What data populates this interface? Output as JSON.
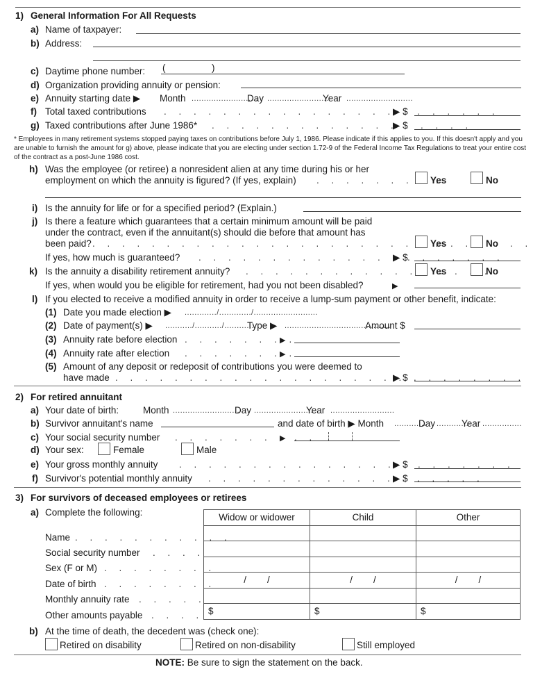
{
  "section1": {
    "num": "1)",
    "title": "General Information For All Requests",
    "a": {
      "label": "a)",
      "text": "Name of taxpayer:",
      "value": ""
    },
    "b": {
      "label": "b)",
      "text": "Address:",
      "value_line1": "",
      "value_line2": ""
    },
    "c": {
      "label": "c)",
      "text": "Daytime phone number:",
      "paren_open": "(",
      "paren_close": ")",
      "value": ""
    },
    "d": {
      "label": "d)",
      "text": "Organization providing annuity or pension:",
      "value": ""
    },
    "e": {
      "label": "e)",
      "text": "Annuity starting date ▶",
      "month": "Month",
      "day": "Day",
      "year": "Year"
    },
    "f": {
      "label": "f)",
      "text": "Total taxed contributions",
      "currency": "▶ $",
      "value": ""
    },
    "g": {
      "label": "g)",
      "text": "Taxed contributions after June 1986*",
      "currency": "▶ $",
      "value": ""
    },
    "footnote": "* Employees in many retirement systems stopped paying taxes on contributions before July 1, 1986. Please indicate if this applies to you. If this doesn't apply and you are unable to furnish the amount for g) above, please indicate that you are electing under section 1.72-9 of the Federal Income Tax Regulations to treat your entire cost of the contract as a post-June 1986 cost.",
    "h": {
      "label": "h)",
      "line1": "Was the employee (or retiree) a nonresident alien at any time during his or her",
      "line2": "employment on which the annuity is figured? (If yes, explain)",
      "yes": "Yes",
      "no": "No"
    },
    "i": {
      "label": "i)",
      "text": "Is the annuity for life or for a specified period? (Explain.)"
    },
    "j": {
      "label": "j)",
      "line1": "Is there a feature which guarantees that a certain minimum amount will be paid",
      "line2": "under the contract, even if the annuitant(s) should die before that amount has",
      "line3": "been paid?",
      "yes": "Yes",
      "no": "No",
      "followup": "If yes, how much is guaranteed?",
      "currency": "▶ $"
    },
    "k": {
      "label": "k)",
      "text": "Is the annuity a disability retirement annuity?",
      "yes": "Yes",
      "no": "No",
      "followup": "If yes, when would you be eligible for retirement, had you not been disabled?",
      "arrow": "▶"
    },
    "l": {
      "label": "l)",
      "text": "If you elected to receive a modified annuity in order to receive a lump-sum payment or other benefit, indicate:",
      "items": [
        {
          "num": "(1)",
          "text": "Date you made election ▶"
        },
        {
          "num": "(2)",
          "text": "Date of payment(s) ▶",
          "type": "Type ▶",
          "amount": "Amount  $"
        },
        {
          "num": "(3)",
          "text": "Annuity rate before election",
          "arrow": "▶"
        },
        {
          "num": "(4)",
          "text": "Annuity rate after election",
          "arrow": "▶"
        },
        {
          "num": "(5)",
          "line1": "Amount of any deposit or redeposit of contributions you were deemed to",
          "line2": "have made",
          "currency": "▶ $"
        }
      ]
    }
  },
  "section2": {
    "num": "2)",
    "title": "For retired annuitant",
    "a": {
      "label": "a)",
      "text": "Your date of birth:",
      "month": "Month",
      "day": "Day",
      "year": "Year"
    },
    "b": {
      "label": "b)",
      "text": "Survivor annuitant's name",
      "dob": "and date of birth ▶ Month",
      "day": "Day",
      "year": "Year"
    },
    "c": {
      "label": "c)",
      "text": "Your social security number",
      "arrow": "▶"
    },
    "d": {
      "label": "d)",
      "text": "Your sex:",
      "female": "Female",
      "male": "Male"
    },
    "e": {
      "label": "e)",
      "text": "Your gross monthly annuity",
      "currency": "▶ $"
    },
    "f": {
      "label": "f)",
      "text": "Survivor's potential monthly annuity",
      "currency": "▶ $"
    }
  },
  "section3": {
    "num": "3)",
    "title": "For survivors of deceased employees or retirees",
    "a": {
      "label": "a)",
      "text": "Complete the following:",
      "columns": [
        "Widow or widower",
        "Child",
        "Other"
      ],
      "rows": [
        {
          "label": "Name",
          "cells": [
            "",
            "",
            ""
          ]
        },
        {
          "label": "Social security number",
          "cells": [
            "",
            "",
            ""
          ]
        },
        {
          "label": "Sex (F or M)",
          "cells": [
            "",
            "",
            ""
          ]
        },
        {
          "label": "Date of birth",
          "cells": [
            "/        /",
            "/        /",
            "/        /"
          ]
        },
        {
          "label": "Monthly annuity rate",
          "cells": [
            "",
            "",
            ""
          ]
        },
        {
          "label": "Other amounts payable",
          "cells": [
            "$",
            "$",
            "$"
          ]
        }
      ]
    },
    "b": {
      "label": "b)",
      "text": "At the time of death, the decedent was (check one):",
      "options": [
        "Retired on disability",
        "Retired on non-disability",
        "Still employed"
      ]
    }
  },
  "note": {
    "bold": "NOTE:",
    "text": " Be sure to sign the statement on the back."
  }
}
